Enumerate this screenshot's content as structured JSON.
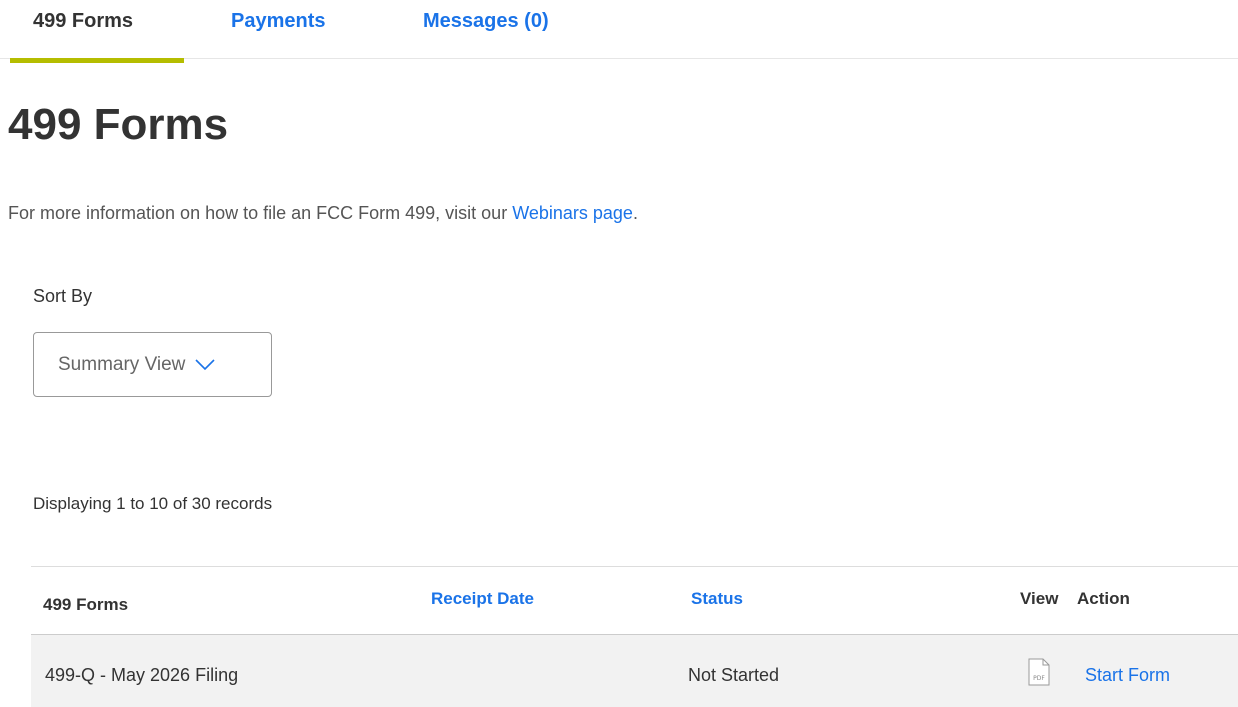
{
  "tabs": [
    {
      "label": "499 Forms",
      "active": true
    },
    {
      "label": "Payments",
      "active": false
    },
    {
      "label": "Messages (0)",
      "active": false
    }
  ],
  "page_title": "499 Forms",
  "info": {
    "text": "For more information on how to file an FCC Form 499, visit our ",
    "link_label": "Webinars page",
    "suffix": "."
  },
  "sort": {
    "label": "Sort By",
    "selected": "Summary View"
  },
  "records_summary": "Displaying 1 to 10 of 30 records",
  "table": {
    "headers": {
      "form": "499 Forms",
      "receipt_date": "Receipt Date",
      "status": "Status",
      "view": "View",
      "action": "Action"
    },
    "rows": [
      {
        "form": "499-Q - May 2026 Filing",
        "receipt_date": "",
        "status": "Not Started",
        "view_icon": "pdf-icon",
        "action": "Start Form"
      }
    ]
  },
  "colors": {
    "link": "#1a73e8",
    "tab_underline": "#b5bd00",
    "row_background": "#f2f2f2"
  }
}
